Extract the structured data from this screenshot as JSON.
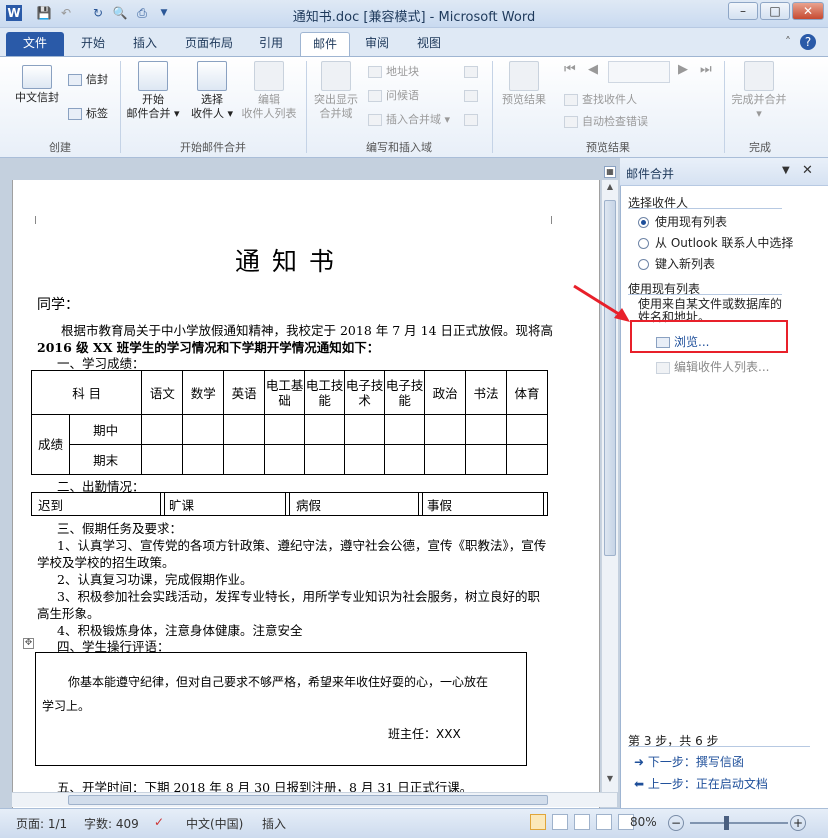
{
  "window": {
    "title": "通知书.doc [兼容模式] - Microsoft Word",
    "word_icon": "W"
  },
  "tabs": [
    "文件",
    "开始",
    "插入",
    "页面布局",
    "引用",
    "邮件",
    "审阅",
    "视图"
  ],
  "ribbon": {
    "groups": {
      "create": "创建",
      "start_merge": "开始邮件合并",
      "write_insert": "编写和插入域",
      "preview": "预览结果",
      "finish": "完成"
    },
    "create": {
      "chinese_envelope": "中文信封",
      "envelope": "信封",
      "labels": "标签"
    },
    "start_merge": {
      "start_line1": "开始",
      "start_line2": "邮件合并",
      "select_line1": "选择",
      "select_line2": "收件人",
      "edit_line1": "编辑",
      "edit_line2": "收件人列表"
    },
    "write_insert": {
      "highlight_line1": "突出显示",
      "highlight_line2": "合并域",
      "address_block": "地址块",
      "greeting": "问候语",
      "insert_field": "插入合并域"
    },
    "preview": {
      "preview_results": "预览结果",
      "find_recipient": "查找收件人",
      "auto_check": "自动检查错误"
    },
    "finish": {
      "finish_merge": "完成并合并"
    }
  },
  "document": {
    "heading": "通 知 书",
    "salutation": "同学：",
    "p1a": "根据市教育局关于中小学放假通知精神，我校定于 2018 年 7 月 14 日正式放假。现将高",
    "p1b": "2016 级 XX 班学生的学习情况和下学期开学情况通知如下：",
    "s1": "一、学习成绩：",
    "table_headers": [
      "科  目",
      "语文",
      "数学",
      "英语",
      "电工基础",
      "电工技能",
      "电子技术",
      "电子技能",
      "政治",
      "书法",
      "体育"
    ],
    "score_label": "成绩",
    "rows": [
      "期中",
      "期末"
    ],
    "s2": "二、出勤情况：",
    "attendance": [
      "迟到",
      "旷课",
      "病假",
      "事假"
    ],
    "s3": "三、假期任务及要求：",
    "t1a": "1、认真学习、宣传党的各项方针政策、遵纪守法，遵守社会公德，宣传《职教法》，宣传",
    "t1b": "学校及学校的招生政策。",
    "t2": "2、认真复习功课，完成假期作业。",
    "t3a": "3、积极参加社会实践活动，发挥专业特长，用所学专业知识为社会服务，树立良好的职",
    "t3b": "高生形象。",
    "t4": "4、积极锻炼身体，注意身体健康。注意安全",
    "s4": "四、学生操行评语：",
    "comment1": "你基本能遵守纪律，但对自己要求不够严格，希望来年收住好耍的心，一心放在",
    "comment2": "学习上。",
    "teacher": "班主任：XXX",
    "s5": "五、开学时间：下期 2018 年 8 月 30 日报到注册，8 月 31 日正式行课。"
  },
  "pane": {
    "title": "邮件合并",
    "select_recipients": "选择收件人",
    "options": [
      "使用现有列表",
      "从 Outlook 联系人中选择",
      "键入新列表"
    ],
    "selected_option": 0,
    "use_existing": "使用现有列表",
    "desc": "使用来自某文件或数据库的姓名和地址。",
    "browse": "浏览...",
    "edit_list": "编辑收件人列表...",
    "step": "第 3 步，共 6 步",
    "next": "下一步：撰写信函",
    "prev": "上一步：正在启动文档"
  },
  "status": {
    "page": "页面: 1/1",
    "words": "字数: 409",
    "lang": "中文(中国)",
    "mode": "插入",
    "zoom": "80%"
  },
  "colors": {
    "annotation": "#e8202a",
    "accent": "#2a5aa8"
  }
}
